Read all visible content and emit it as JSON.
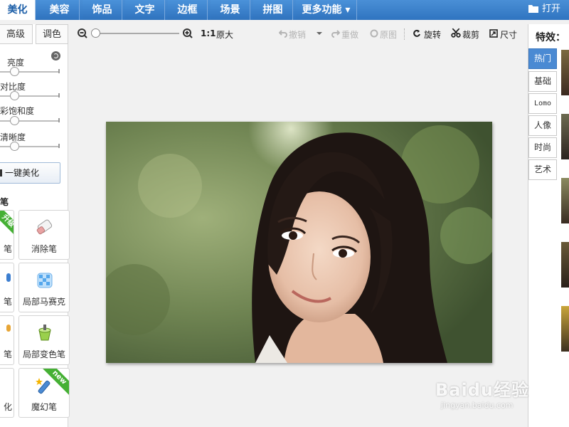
{
  "tabs": [
    {
      "label": "美化",
      "active": true
    },
    {
      "label": "美容",
      "active": false
    },
    {
      "label": "饰品",
      "active": false
    },
    {
      "label": "文字",
      "active": false
    },
    {
      "label": "边框",
      "active": false
    },
    {
      "label": "场景",
      "active": false
    },
    {
      "label": "拼图",
      "active": false
    },
    {
      "label": "更多功能 ▾",
      "active": false
    }
  ],
  "open_label": "打开",
  "left": {
    "sub_tabs": [
      "高级",
      "调色"
    ],
    "sliders": [
      {
        "label": "亮度",
        "level": 0.2
      },
      {
        "label": "对比度",
        "level": 0.2
      },
      {
        "label": "彩饱和度",
        "level": 0.2
      },
      {
        "label": "清晰度",
        "level": 0.2
      }
    ],
    "one_click": "一键美化",
    "section_title": "笔",
    "tools": [
      {
        "label": "笔",
        "badge": "升级"
      },
      {
        "label": "消除笔"
      },
      {
        "label": "笔"
      },
      {
        "label": "局部马赛克"
      },
      {
        "label": "笔"
      },
      {
        "label": "局部变色笔"
      },
      {
        "label": "化"
      },
      {
        "label": "魔幻笔",
        "badge": "new"
      }
    ]
  },
  "toolbar": {
    "zoom_ratio": "1:1",
    "original_size": "原大",
    "undo": "撤销",
    "redo": "重做",
    "original": "原图",
    "rotate": "旋转",
    "crop": "裁剪",
    "size": "尺寸"
  },
  "right": {
    "title": "特效：",
    "tabs": [
      "热门",
      "基础",
      "Lomo",
      "人像",
      "时尚",
      "艺术"
    ]
  },
  "watermark": {
    "main": "Baidu经验",
    "sub": "jingyan.baidu.com"
  },
  "colors": {
    "tab_bar": "#2f74c0",
    "accent": "#4a8ad3",
    "badge_green": "#45b034"
  }
}
